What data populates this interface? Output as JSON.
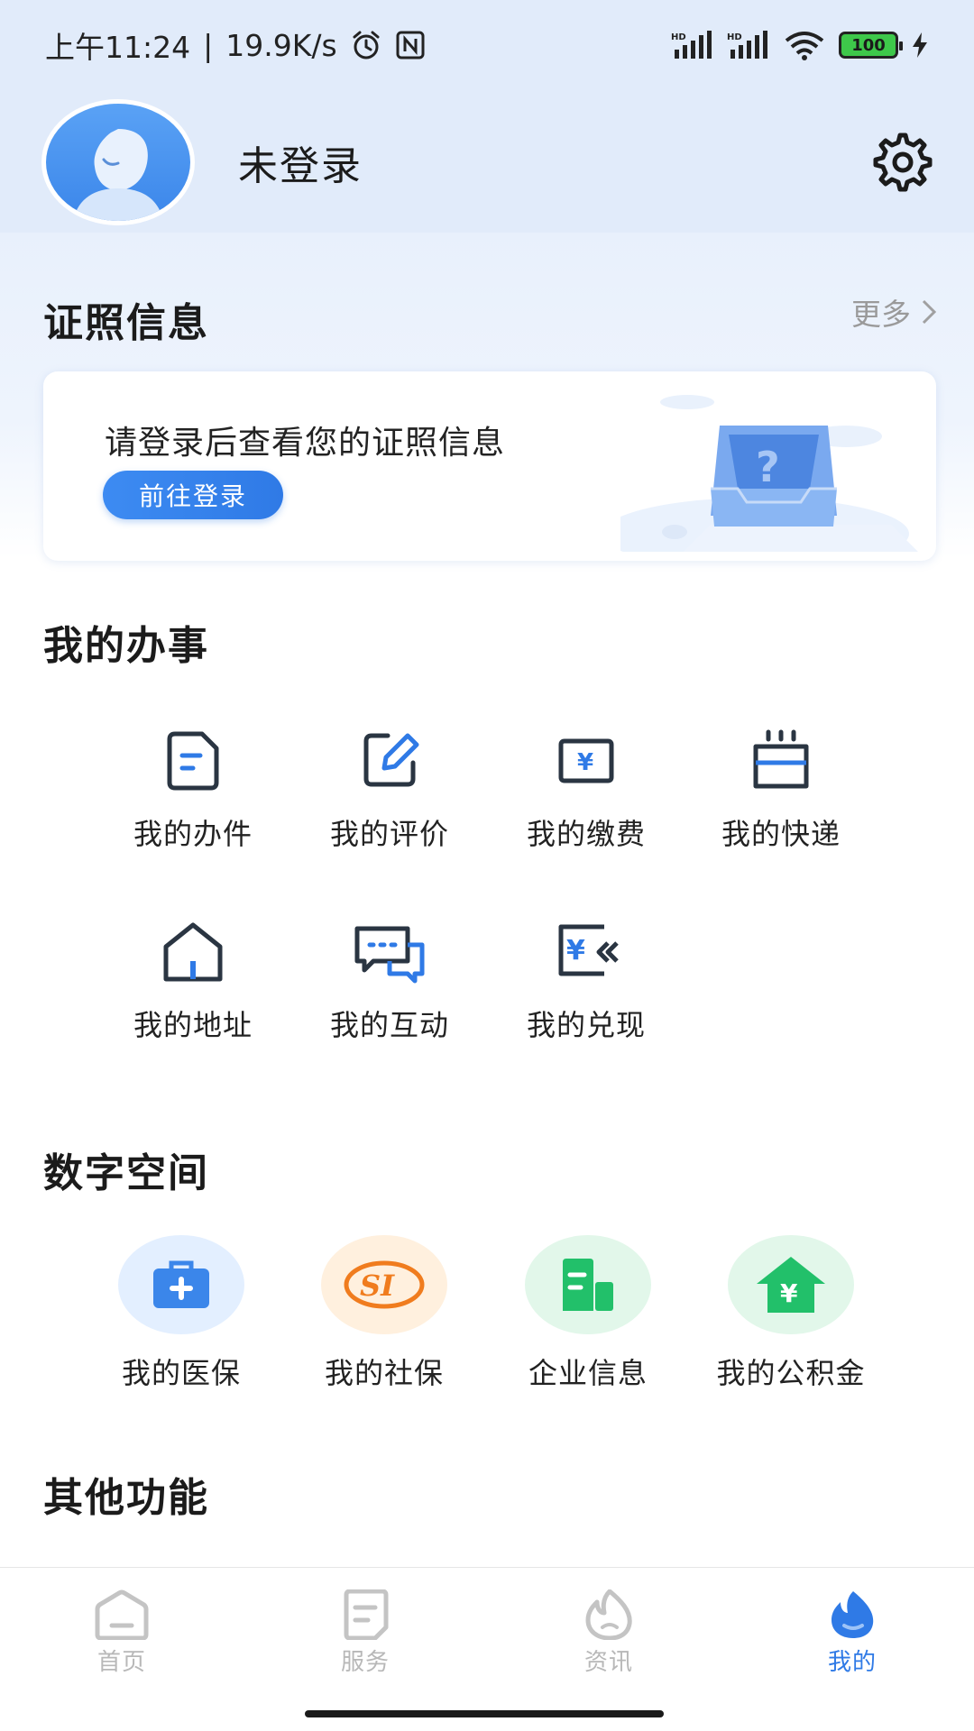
{
  "status_bar": {
    "time": "上午11:24",
    "separator": "|",
    "speed": "19.9K/s",
    "battery": "100",
    "icons": [
      "alarm-icon",
      "nfc-icon",
      "hd-signal-icon",
      "hd-signal-icon",
      "wifi-icon",
      "battery-icon",
      "charging-icon"
    ]
  },
  "profile": {
    "username": "未登录",
    "icons": [
      "avatar-icon",
      "settings-gear-icon"
    ]
  },
  "certificates": {
    "title": "证照信息",
    "more": "更多",
    "prompt": "请登录后查看您的证照信息",
    "login_button": "前往登录"
  },
  "my_affairs": {
    "title": "我的办事",
    "items": [
      {
        "label": "我的办件",
        "icon": "document-icon"
      },
      {
        "label": "我的评价",
        "icon": "edit-icon"
      },
      {
        "label": "我的缴费",
        "icon": "payment-icon"
      },
      {
        "label": "我的快递",
        "icon": "express-box-icon"
      },
      {
        "label": "我的地址",
        "icon": "home-address-icon"
      },
      {
        "label": "我的互动",
        "icon": "chat-icon"
      },
      {
        "label": "我的兑现",
        "icon": "cash-redeem-icon"
      }
    ]
  },
  "digital_space": {
    "title": "数字空间",
    "items": [
      {
        "label": "我的医保",
        "icon": "medical-kit-icon",
        "color": "#3b86ea",
        "bg": "#e3efff"
      },
      {
        "label": "我的社保",
        "icon": "social-security-icon",
        "color": "#f07c1e",
        "bg": "#fff0de"
      },
      {
        "label": "企业信息",
        "icon": "building-icon",
        "color": "#22c06a",
        "bg": "#e2f7ea"
      },
      {
        "label": "我的公积金",
        "icon": "housing-fund-icon",
        "color": "#22c06a",
        "bg": "#e2f7ea"
      }
    ]
  },
  "other_functions": {
    "title": "其他功能"
  },
  "bottom_nav": {
    "items": [
      {
        "label": "首页",
        "icon": "home-icon"
      },
      {
        "label": "服务",
        "icon": "service-icon"
      },
      {
        "label": "资讯",
        "icon": "news-flame-icon"
      },
      {
        "label": "我的",
        "icon": "mine-flame-icon"
      }
    ],
    "active": "我的",
    "active_color": "#2f7ae6",
    "inactive_color": "#b8b8b8"
  }
}
